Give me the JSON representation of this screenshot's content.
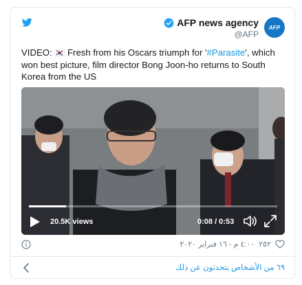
{
  "account": {
    "name": "AFP news agency",
    "handle": "@AFP",
    "avatar_text": "AFP"
  },
  "tweet": {
    "prefix": "VIDEO: ",
    "flag": "🇰🇷",
    "part1": " Fresh from his Oscars triumph for '",
    "hashtag": "#Parasite",
    "part2": "', which won best picture, film director Bong Joon-ho returns to South Korea from the US"
  },
  "video": {
    "views": "20.5K views",
    "time": "0:08 / 0:53",
    "progress_fraction": 0.15
  },
  "meta": {
    "likes": "٢٥٢",
    "timestamp": "٤:٠٠ م - ١٦ فبراير ٢٠٢٠"
  },
  "footer": {
    "people_talking": "٦٩ من الأشخاص يتحدثون عن ذلك"
  },
  "colors": {
    "brand_blue": "#1da1f2",
    "link": "#1b95e0",
    "afp_blue": "#1777c4"
  },
  "icons": [
    "twitter-bird-icon",
    "verified-icon",
    "play-icon",
    "volume-icon",
    "fullscreen-icon",
    "info-icon",
    "heart-icon",
    "chevron-left-icon"
  ]
}
